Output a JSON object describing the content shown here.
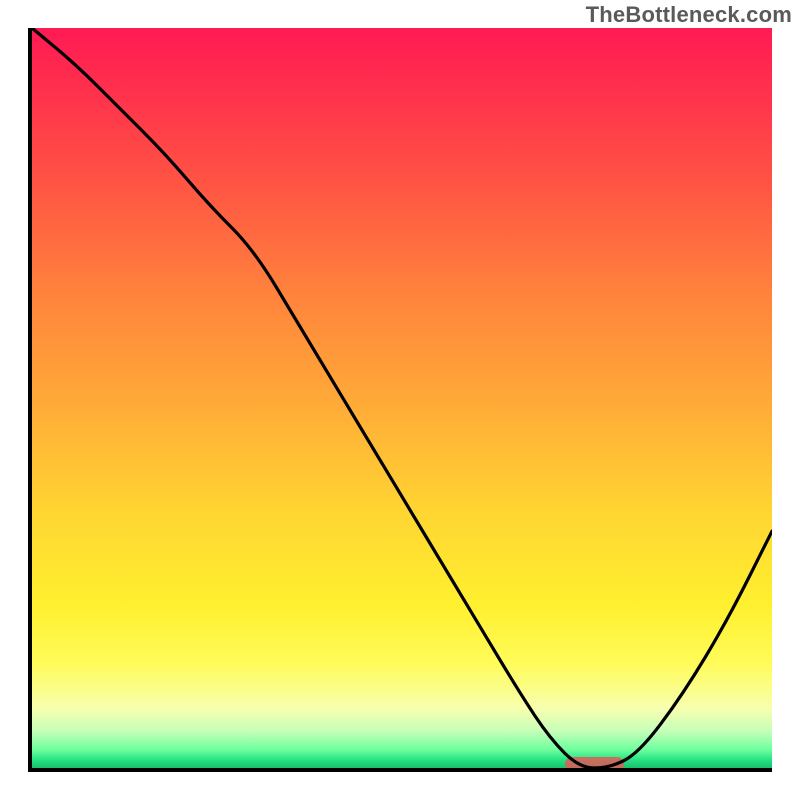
{
  "watermark": "TheBottleneck.com",
  "chart_data": {
    "type": "line",
    "title": "",
    "xlabel": "",
    "ylabel": "",
    "xlim": [
      0,
      100
    ],
    "ylim": [
      0,
      100
    ],
    "grid": false,
    "x": [
      0,
      6,
      12,
      18,
      24,
      30,
      36,
      42,
      48,
      54,
      60,
      66,
      70,
      74,
      78,
      82,
      88,
      94,
      100
    ],
    "values": [
      100,
      95,
      89,
      83,
      76,
      70,
      60,
      50,
      40,
      30,
      20,
      10,
      4,
      0,
      0,
      2,
      10,
      20,
      32
    ],
    "marker": {
      "x_start": 72,
      "x_end": 80,
      "y": 0.5
    },
    "gradient_stops": [
      {
        "pos": 0,
        "color": "#ff1a54"
      },
      {
        "pos": 8,
        "color": "#ff2f4d"
      },
      {
        "pos": 22,
        "color": "#ff5743"
      },
      {
        "pos": 36,
        "color": "#ff833c"
      },
      {
        "pos": 52,
        "color": "#ffae37"
      },
      {
        "pos": 65,
        "color": "#ffd432"
      },
      {
        "pos": 78,
        "color": "#fff02f"
      },
      {
        "pos": 86,
        "color": "#fffc5a"
      },
      {
        "pos": 92,
        "color": "#f7ffb0"
      },
      {
        "pos": 95,
        "color": "#c6ffb9"
      },
      {
        "pos": 97.5,
        "color": "#6fff9e"
      },
      {
        "pos": 99,
        "color": "#22e080"
      },
      {
        "pos": 100,
        "color": "#1bc06c"
      }
    ]
  }
}
